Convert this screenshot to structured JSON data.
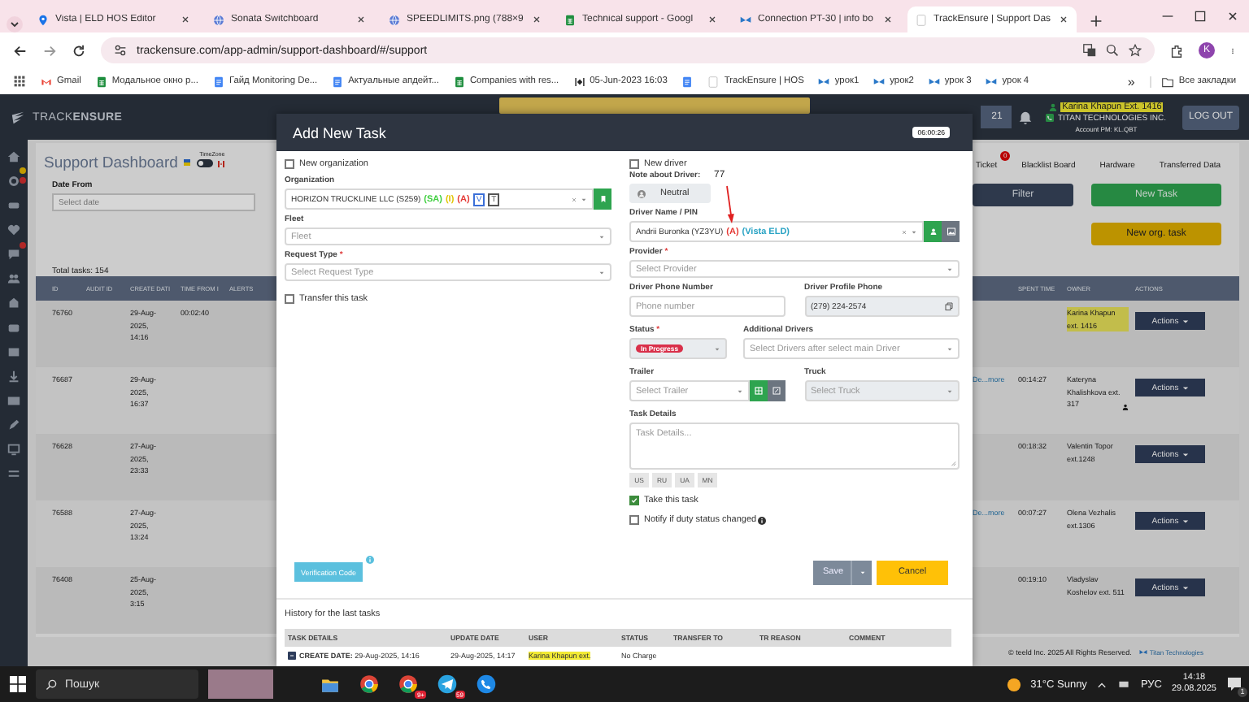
{
  "browser": {
    "tabs": [
      {
        "title": "Vista | ELD HOS Editor",
        "kind": "pin",
        "selected": false
      },
      {
        "title": "Sonata Switchboard",
        "kind": "globe",
        "selected": false
      },
      {
        "title": "SPEEDLIMITS.png (788×9",
        "kind": "globe",
        "selected": false
      },
      {
        "title": "Technical support - Googl",
        "kind": "sheet",
        "selected": false
      },
      {
        "title": "Connection PT-30 | info bo",
        "kind": "bird",
        "selected": false
      },
      {
        "title": "TrackEnsure | Support Das",
        "kind": "blank",
        "selected": true
      }
    ],
    "address": "trackensure.com/app-admin/support-dashboard/#/support",
    "profile_initial": "K",
    "bookmarks": [
      {
        "label": "Gmail",
        "kind": "gmail"
      },
      {
        "label": "Модальное окно р...",
        "kind": "sheet"
      },
      {
        "label": "Гайд Monitoring De...",
        "kind": "doc"
      },
      {
        "label": "Актуальные апдейт...",
        "kind": "doc"
      },
      {
        "label": "Companies with res...",
        "kind": "sheet"
      },
      {
        "label": "05-Jun-2023 16:03",
        "kind": "clock"
      },
      {
        "kind": "doc"
      },
      {
        "label": "TrackEnsure | HOS",
        "kind": "blank"
      },
      {
        "label": "урок1",
        "kind": "bird"
      },
      {
        "label": "урок2",
        "kind": "bird"
      },
      {
        "label": "урок 3",
        "kind": "bird"
      },
      {
        "label": "урок 4",
        "kind": "bird"
      }
    ],
    "more_bookmarks": "»",
    "all_bookmarks": "Все закладки"
  },
  "app_header": {
    "logo": "TRACK**ENSURE**",
    "counter": "21",
    "user": "Karina Khapun Ext. 1416",
    "company": "TITAN TECHNOLOGIES INC.",
    "account": "Account PM: KL.QBT",
    "logout": "LOG OUT"
  },
  "dashboard": {
    "title": "Support Dashboard",
    "timezone_label": "TimeZone",
    "timezone_on": false,
    "date_from": {
      "label": "Date From",
      "placeholder": "Select date"
    },
    "nav": [
      {
        "label": "Ticket",
        "badge": "0"
      },
      {
        "label": "Blacklist Board"
      },
      {
        "label": "Hardware"
      },
      {
        "label": "Transferred Data"
      }
    ],
    "filter": "Filter",
    "new_task": "New Task",
    "new_org_task": "New org. task",
    "total": "Total tasks: 154",
    "columns_left": [
      "ID",
      "AUDIT ID",
      "CREATE DATI",
      "TIME FROM I",
      "ALERTS"
    ],
    "columns_right": [
      "SPENT TIME",
      "OWNER",
      "ACTIONS"
    ],
    "rows": [
      {
        "id": "76760",
        "create_date": "29-Aug-2025, 14:16",
        "time_from": "00:02:40",
        "owner": "Karina Khapun ext. 1416",
        "owner_highlighted": true,
        "owner_badge": false,
        "action": "Actions"
      },
      {
        "id": "76687",
        "create_date": "29-Aug-2025, 16:37",
        "details": "De...more",
        "spent_time": "00:14:27",
        "owner": "Kateryna Khalishkova ext. 317",
        "owner_highlighted": false,
        "owner_badge": true,
        "action": "Actions"
      },
      {
        "id": "76628",
        "create_date": "27-Aug-2025, 23:33",
        "spent_time": "00:18:32",
        "owner": "Valentin Topor ext.1248",
        "owner_highlighted": false,
        "owner_badge": false,
        "action": "Actions"
      },
      {
        "id": "76588",
        "create_date": "27-Aug-2025, 13:24",
        "details": "De...more",
        "spent_time": "00:07:27",
        "owner": "Olena Vezhalis ext.1306",
        "owner_highlighted": false,
        "owner_badge": false,
        "action": "Actions"
      },
      {
        "id": "76408",
        "create_date": "25-Aug-2025, 3:15",
        "spent_time": "00:19:10",
        "owner": "Vladyslav Koshelov ext. 511",
        "owner_highlighted": false,
        "owner_badge": false,
        "action": "Actions"
      }
    ],
    "footer": "© teeld Inc. 2025 All Rights Reserved.",
    "footer_brand": "Titan Technologies"
  },
  "modal": {
    "title": "Add New Task",
    "timer": "06:00:26",
    "new_organization": {
      "label": "New organization",
      "checked": false
    },
    "organization": {
      "label": "Organization",
      "value": "HORIZON TRUCKLINE LLC (S259)",
      "tags": [
        {
          "text": "(SA)",
          "color": "#3fcf3f"
        },
        {
          "text": "(I)",
          "color": "#e0c400"
        },
        {
          "text": "(A)",
          "color": "#e53935"
        }
      ],
      "boxed_tags": [
        {
          "text": "V",
          "color": "#3b6fd8"
        },
        {
          "text": "T",
          "color": "#555555"
        }
      ]
    },
    "fleet": {
      "label": "Fleet",
      "placeholder": "Fleet"
    },
    "request_type": {
      "label": "Request Type",
      "required_mark": "*",
      "placeholder": "Select Request Type"
    },
    "transfer": {
      "label": "Transfer this task",
      "checked": false
    },
    "new_driver": {
      "label": "New driver",
      "checked": false
    },
    "driver_note": {
      "label": "Note about Driver:",
      "button": "Neutral"
    },
    "annotation": "77",
    "driver": {
      "label": "Driver Name / PIN",
      "value": "Andrii Buronka (YZ3YU)",
      "tags": [
        {
          "text": "(A)",
          "color": "#e53935"
        },
        {
          "text": "(Vista ELD)",
          "color": "#29a3c4"
        }
      ]
    },
    "provider": {
      "label": "Provider",
      "required_mark": "*",
      "placeholder": "Select Provider"
    },
    "driver_phone": {
      "label": "Driver Phone Number",
      "placeholder": "Phone number"
    },
    "profile_phone": {
      "label": "Driver Profile Phone",
      "value": "(279) 224-2574"
    },
    "status": {
      "label": "Status",
      "required_mark": "*",
      "value": "In Progress"
    },
    "additional_drivers": {
      "label": "Additional Drivers",
      "placeholder": "Select Drivers after select main Driver"
    },
    "trailer": {
      "label": "Trailer",
      "placeholder": "Select Trailer"
    },
    "truck": {
      "label": "Truck",
      "placeholder": "Select Truck",
      "disabled": true
    },
    "task_details": {
      "label": "Task Details",
      "placeholder": "Task Details..."
    },
    "languages": [
      "US",
      "RU",
      "UA",
      "MN"
    ],
    "take_task": {
      "label": "Take this task",
      "checked": true
    },
    "notify": {
      "label": "Notify if duty status changed",
      "checked": false
    },
    "verification": "Verification Code",
    "save": "Save",
    "cancel": "Cancel",
    "history": {
      "title": "History for the last tasks",
      "columns": [
        "TASK DETAILS",
        "UPDATE DATE",
        "USER",
        "STATUS",
        "TRANSFER TO",
        "TR REASON",
        "COMMENT"
      ],
      "rows": [
        {
          "details": "**CREATE DATE:** 29-Aug-2025, 14:16",
          "update_date": "29-Aug-2025, 14:17",
          "user": "Karina Khapun ext.",
          "user_highlighted": true,
          "status": "No Charge"
        }
      ]
    }
  },
  "taskbar": {
    "search": "Пошук",
    "apps": [
      {
        "kind": "folder"
      },
      {
        "kind": "chrome"
      },
      {
        "kind": "chrome",
        "badge": "9+"
      },
      {
        "kind": "telegram",
        "badge": "59"
      },
      {
        "kind": "phone"
      }
    ],
    "weather": "31°C Sunny",
    "language": "РУС",
    "time": "14:18",
    "date": "29.08.2025",
    "notifications": "1"
  }
}
